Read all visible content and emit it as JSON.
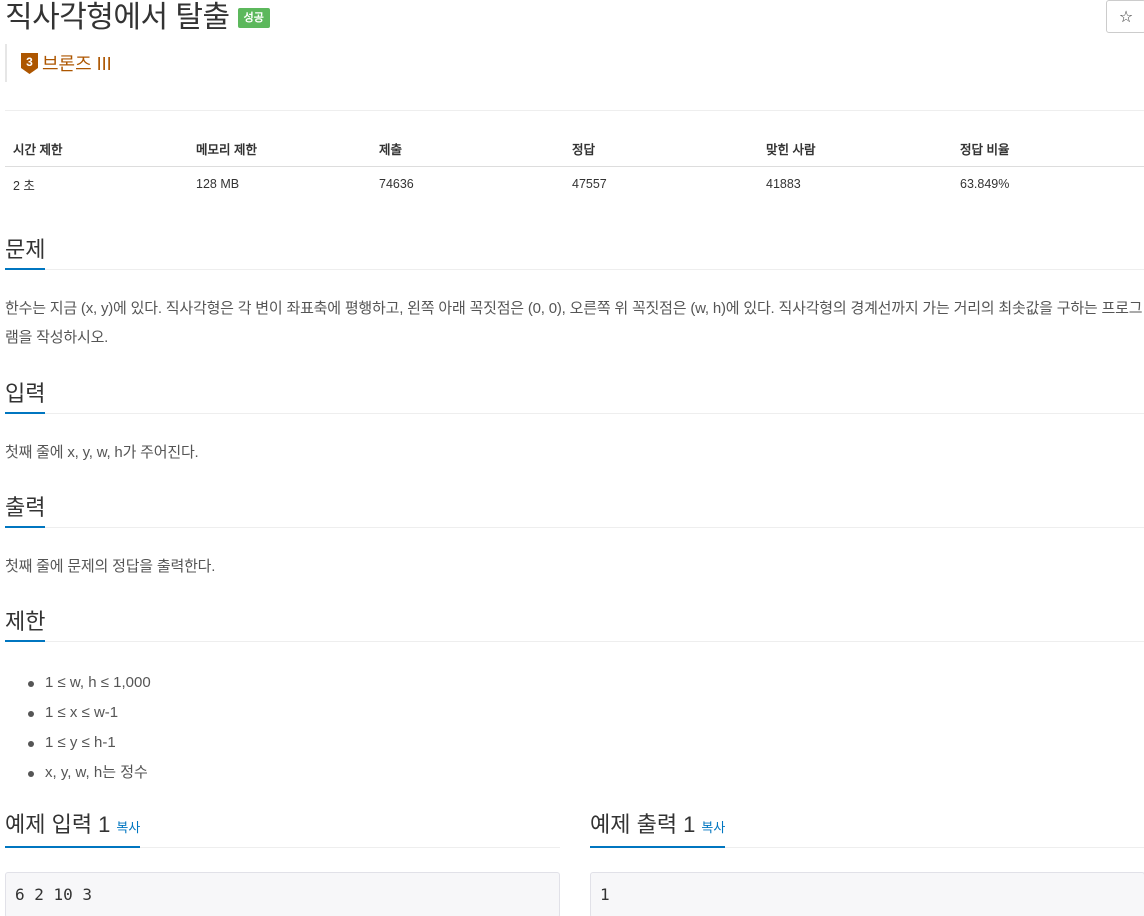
{
  "problem": {
    "title": "직사각형에서 탈출",
    "status_badge": "성공",
    "star": "☆",
    "tier": {
      "number": "3",
      "label": "브론즈 III",
      "color": "#ad5600"
    }
  },
  "info_table": {
    "headers": [
      "시간 제한",
      "메모리 제한",
      "제출",
      "정답",
      "맞힌 사람",
      "정답 비율"
    ],
    "values": [
      "2 초",
      "128 MB",
      "74636",
      "47557",
      "41883",
      "63.849%"
    ]
  },
  "sections": {
    "problem": {
      "heading": "문제",
      "text": "한수는 지금 (x, y)에 있다. 직사각형은 각 변이 좌표축에 평행하고, 왼쪽 아래 꼭짓점은 (0, 0), 오른쪽 위 꼭짓점은 (w, h)에 있다. 직사각형의 경계선까지 가는 거리의 최솟값을 구하는 프로그램을 작성하시오."
    },
    "input": {
      "heading": "입력",
      "text": "첫째 줄에 x, y, w, h가 주어진다."
    },
    "output": {
      "heading": "출력",
      "text": "첫째 줄에 문제의 정답을 출력한다."
    },
    "limits": {
      "heading": "제한",
      "items": [
        "1 ≤ w, h ≤ 1,000",
        "1 ≤ x ≤ w-1",
        "1 ≤ y ≤ h-1",
        "x, y, w, h는 정수"
      ]
    }
  },
  "samples": {
    "input": {
      "heading": "예제 입력 1",
      "copy": "복사",
      "content": "6 2 10 3"
    },
    "output": {
      "heading": "예제 출력 1",
      "copy": "복사",
      "content": "1"
    }
  },
  "colors": {
    "accent": "#0076c0",
    "success": "#5cb85c",
    "bronze": "#ad5600"
  }
}
